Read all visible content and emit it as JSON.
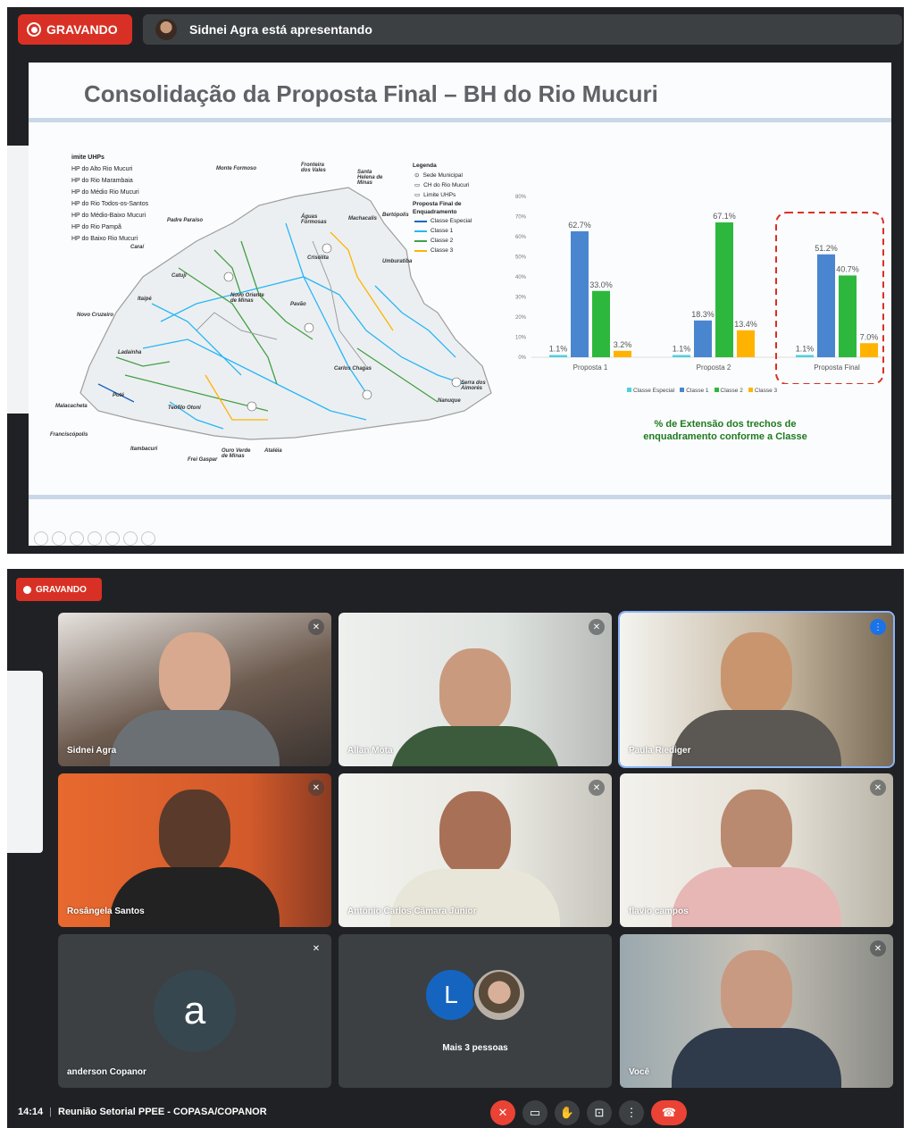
{
  "top": {
    "recording_label": "GRAVANDO",
    "presenter_text": "Sidnei Agra está apresentando",
    "slide": {
      "title": "Consolidação da Proposta Final – BH do Rio Mucuri",
      "uhp_legend": {
        "heading": "imite UHPs",
        "items": [
          "HP do Alto Rio Mucuri",
          "HP do Rio Marambaia",
          "HP do Médio Rio Mucuri",
          "HP do Rio Todos-os-Santos",
          "HP do Médio-Baixo Mucuri",
          "HP do Rio Pampã",
          "HP do Baixo Rio Mucuri"
        ]
      },
      "map_legend": {
        "heading": "Legenda",
        "sede": "Sede Municipal",
        "ch": "CH do Rio Mucuri",
        "limite": "Limite UHPs",
        "proposta": "Proposta Final de Enquadramento",
        "classes": [
          {
            "label": "Classe Especial",
            "color": "#1565c0"
          },
          {
            "label": "Classe 1",
            "color": "#29b6f6"
          },
          {
            "label": "Classe 2",
            "color": "#43a047"
          },
          {
            "label": "Classe 3",
            "color": "#ffb300"
          }
        ]
      },
      "map_places": [
        "Monte Formoso",
        "Fronteira dos Vales",
        "Santa Helena de Minas",
        "Águas Formosas",
        "Machacalis",
        "Bertópolis",
        "Padre Paraíso",
        "Caraí",
        "Crisólita",
        "Umburatiba",
        "Catuji",
        "Itaipé",
        "Novo Oriente de Minas",
        "Pavão",
        "Novo Cruzeiro",
        "Ladainha",
        "Carlos Chagas",
        "Serra dos Aimorés",
        "Poté",
        "Nanuque",
        "Teófilo Otoni",
        "Malacacheta",
        "Franciscópolis",
        "Itambacuri",
        "Ouro Verde de Minas",
        "Frei Gaspar",
        "Ataléia"
      ],
      "chart_caption_line1": "% de Extensão dos trechos de",
      "chart_caption_line2": "enquadramento conforme a Classe"
    }
  },
  "chart_data": {
    "type": "bar",
    "categories": [
      "Proposta 1",
      "Proposta 2",
      "Proposta Final"
    ],
    "series": [
      {
        "name": "Classe Especial",
        "color": "#4dd0e1",
        "values": [
          1.1,
          1.1,
          1.1
        ]
      },
      {
        "name": "Classe 1",
        "color": "#4a86d0",
        "values": [
          62.7,
          18.3,
          51.2
        ]
      },
      {
        "name": "Classe 2",
        "color": "#2db83d",
        "values": [
          33.0,
          67.1,
          40.7
        ]
      },
      {
        "name": "Classe 3",
        "color": "#ffb300",
        "values": [
          3.2,
          13.4,
          7.0
        ]
      }
    ],
    "data_labels": [
      [
        "1.1%",
        "62.7%",
        "33.0%",
        "3.2%"
      ],
      [
        "1.1%",
        "18.3%",
        "67.1%",
        "13.4%"
      ],
      [
        "1.1%",
        "51.2%",
        "40.7%",
        "7.0%"
      ]
    ],
    "y_ticks": [
      "0%",
      "10%",
      "20%",
      "30%",
      "40%",
      "50%",
      "60%",
      "70%",
      "80%"
    ],
    "ylim": [
      0,
      80
    ],
    "legend_position": "bottom",
    "highlight_category": "Proposta Final"
  },
  "bottom": {
    "recording_label": "GRAVANDO",
    "participants": [
      {
        "name": "Sidnei Agra",
        "muted": true
      },
      {
        "name": "Allan Mota",
        "muted": true
      },
      {
        "name": "Paula Riediger",
        "muted": false,
        "speaking": true
      },
      {
        "name": "Rosângela Santos",
        "muted": true
      },
      {
        "name": "Antônio Carlos Câmara Júnior",
        "muted": true
      },
      {
        "name": "flavio campos",
        "muted": true
      },
      {
        "name": "anderson Copanor",
        "muted": true,
        "initial": "a"
      },
      {
        "name": "Mais 3 pessoas",
        "initial": "L"
      },
      {
        "name": "Você",
        "muted": true
      }
    ],
    "time": "14:14",
    "meeting_title": "Reunião Setorial PPEE - COPASA/COPANOR"
  }
}
